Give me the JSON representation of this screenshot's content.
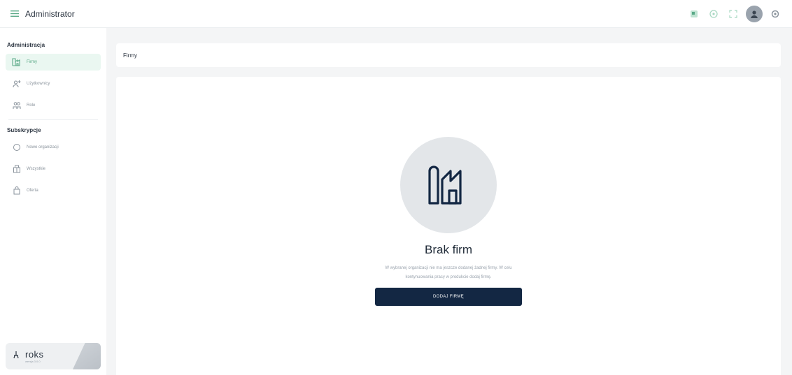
{
  "topbar": {
    "title": "Administrator"
  },
  "sidebar": {
    "sections": [
      {
        "title": "Administracja",
        "items": [
          {
            "label": "Firmy",
            "icon": "building-icon",
            "active": true
          },
          {
            "label": "Użytkownicy",
            "icon": "user-add-icon",
            "active": false
          },
          {
            "label": "Role",
            "icon": "group-icon",
            "active": false
          }
        ]
      },
      {
        "title": "Subskrypcje",
        "items": [
          {
            "label": "Nowe organizacji",
            "icon": "circle-icon",
            "active": false
          },
          {
            "label": "Wszystkie",
            "icon": "box-icon",
            "active": false
          },
          {
            "label": "Oferta",
            "icon": "bag-icon",
            "active": false
          }
        ]
      }
    ],
    "brand": {
      "logo": "roks",
      "version": "wersja 3.0.0"
    }
  },
  "main": {
    "header_title": "Firmy",
    "empty_state": {
      "title": "Brak firm",
      "description": "W wybranej organizacji nie ma jeszcze dodanej żadnej firmy. W celu kontynuowania pracy w produkcie dodaj firmę.",
      "button_label": "DODAJ FIRMĘ"
    }
  },
  "colors": {
    "accent": "#5aa987",
    "active_bg": "#eaf7f1",
    "primary_button": "#132743",
    "main_bg": "#f4f5f6"
  }
}
